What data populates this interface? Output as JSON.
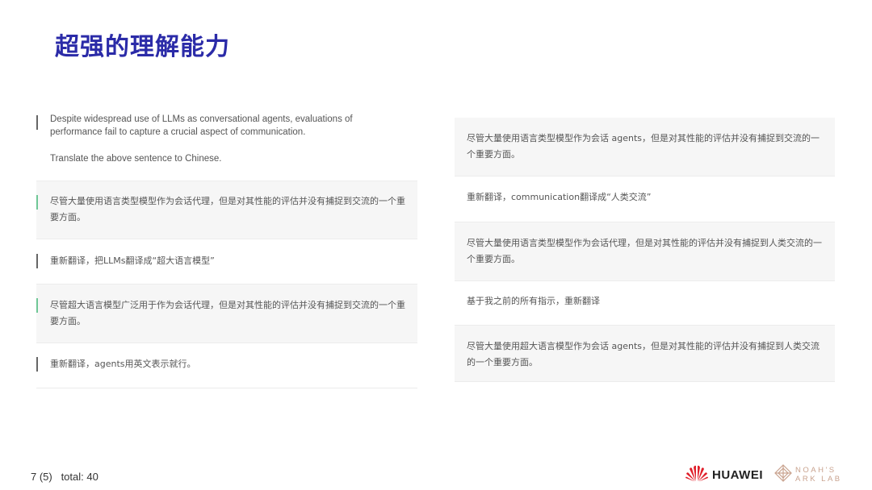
{
  "title": "超强的理解能力",
  "left_column": {
    "prompt": {
      "line1": "Despite widespread use of LLMs as conversational agents, evaluations of",
      "line2": "performance fail to capture a crucial aspect of communication.",
      "line3": "Translate the above sentence to Chinese."
    },
    "messages": [
      {
        "role": "assistant",
        "marker": "green",
        "text": "尽管大量使用语言类型模型作为会话代理，但是对其性能的评估并没有捕捉到交流的一个重要方面。"
      },
      {
        "role": "user",
        "marker": "gray",
        "text": "重新翻译，把LLMs翻译成“超大语言模型”"
      },
      {
        "role": "assistant",
        "marker": "green",
        "text": "尽管超大语言模型广泛用于作为会话代理，但是对其性能的评估并没有捕捉到交流的一个重要方面。"
      },
      {
        "role": "user",
        "marker": "gray",
        "text": "重新翻译，agents用英文表示就行。"
      }
    ]
  },
  "right_column": {
    "messages": [
      {
        "role": "assistant",
        "text": "尽管大量使用语言类型模型作为会话 agents，但是对其性能的评估并没有捕捉到交流的一个重要方面。"
      },
      {
        "role": "user",
        "text": "重新翻译，communication翻译成“人类交流”"
      },
      {
        "role": "assistant",
        "text": "尽管大量使用语言类型模型作为会话代理，但是对其性能的评估并没有捕捉到人类交流的一个重要方面。"
      },
      {
        "role": "user",
        "text": "基于我之前的所有指示，重新翻译"
      },
      {
        "role": "assistant",
        "text": "尽管大量使用超大语言模型作为会话 agents，但是对其性能的评估并没有捕捉到人类交流的一个重要方面。"
      }
    ]
  },
  "footer": {
    "page": "7 (5)   total: 40",
    "brand": "HUAWEI",
    "lab_line1": "NOAH'S",
    "lab_line2": "ARK LAB"
  },
  "colors": {
    "title": "#2b2ba8",
    "assistant_bg": "#f6f6f6",
    "marker_green": "#6fc796",
    "huawei_red": "#e0202b",
    "ark_accent": "#c9a38f"
  }
}
